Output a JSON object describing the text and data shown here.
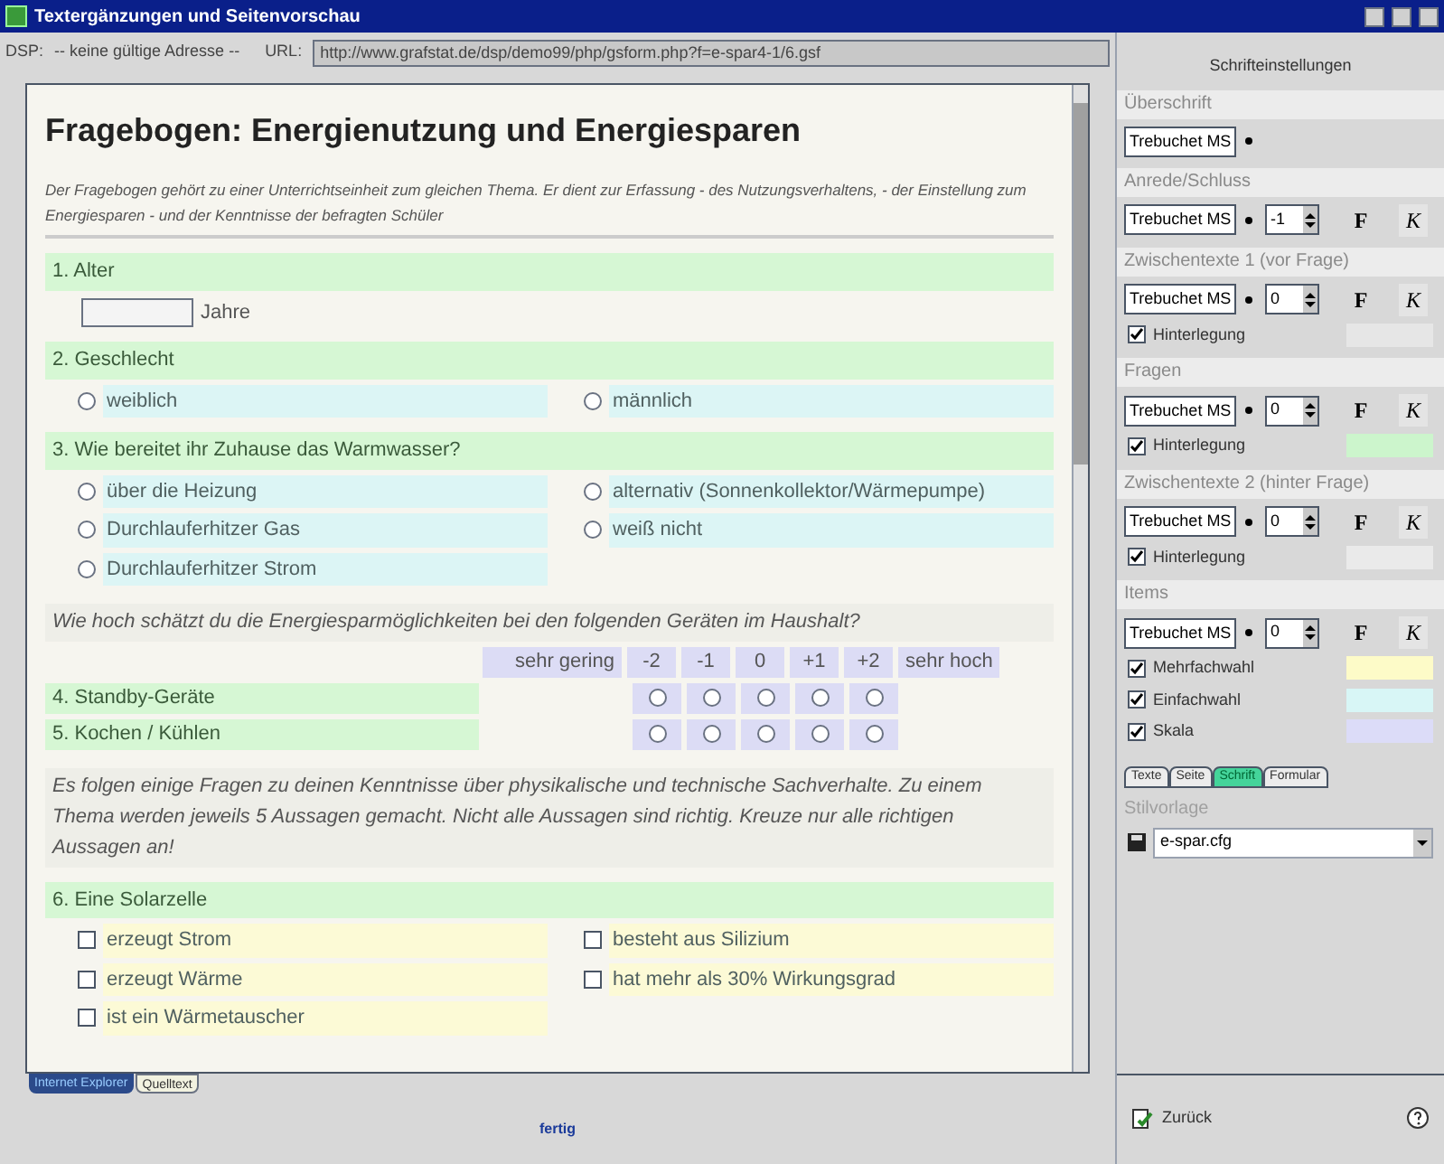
{
  "window": {
    "title": "Textergänzungen und Seitenvorschau"
  },
  "address": {
    "dsp_label": "DSP:",
    "dsp_value": "-- keine gültige Adresse --",
    "url_label": "URL:",
    "url": "http://www.grafstat.de/dsp/demo99/php/gsform.php?f=e-spar4-1/6.gsf"
  },
  "preview": {
    "title": "Fragebogen: Energienutzung und Energiesparen",
    "intro": "Der Fragebogen gehört zu einer Unterrichtseinheit zum gleichen Thema. Er dient zur Erfassung - des Nutzungsverhaltens, - der Einstellung zum Energiesparen - und der Kenntnisse der befragten Schüler",
    "blocks": [
      {
        "kind": "question",
        "label": "1. Alter"
      },
      {
        "kind": "textfield",
        "unit": "Jahre"
      },
      {
        "kind": "question",
        "label": "2. Geschlecht"
      },
      {
        "kind": "radio",
        "options": [
          {
            "label": "weiblich",
            "checked": false
          },
          {
            "label": "männlich",
            "checked": false
          }
        ]
      },
      {
        "kind": "question",
        "label": "3. Wie bereitet ihr Zuhause das Warmwasser?"
      },
      {
        "kind": "radio",
        "options": [
          {
            "label": "über die Heizung",
            "checked": false
          },
          {
            "label": "alternativ (Sonnenkollektor/Wärmepumpe)",
            "checked": false
          },
          {
            "label": "Durchlauferhitzer Gas",
            "checked": false
          },
          {
            "label": "weiß nicht",
            "checked": false
          },
          {
            "label": "Durchlauferhitzer Strom",
            "checked": false
          }
        ]
      },
      {
        "kind": "note",
        "text": "Wie hoch schätzt du die Energiesparmöglichkeiten bei den folgenden Geräten im Haushalt?"
      },
      {
        "kind": "scale",
        "low": "sehr gering",
        "high": "sehr hoch",
        "points": [
          "-2",
          "-1",
          "0",
          "+1",
          "+2"
        ],
        "rows": [
          {
            "label": "4. Standby-Geräte",
            "checked": [
              false,
              false,
              false,
              false,
              false
            ]
          },
          {
            "label": "5. Kochen / Kühlen",
            "checked": [
              false,
              false,
              false,
              false,
              false
            ]
          }
        ]
      },
      {
        "kind": "note",
        "text": "Es folgen einige Fragen zu deinen Kenntnisse über physikalische und technische Sachverhalte. Zu einem Thema werden jeweils 5 Aussagen gemacht. Nicht alle Aussagen sind richtig. Kreuze nur alle richtigen Aussagen an!"
      },
      {
        "kind": "question",
        "label": "6. Eine Solarzelle"
      },
      {
        "kind": "checkbox",
        "options": [
          {
            "label": "erzeugt Strom",
            "checked": false
          },
          {
            "label": "besteht aus Silizium",
            "checked": false
          },
          {
            "label": "erzeugt Wärme",
            "checked": false
          },
          {
            "label": "hat mehr als 30% Wirkungsgrad",
            "checked": false
          },
          {
            "label": "ist ein Wärmetauscher",
            "checked": false
          }
        ]
      }
    ]
  },
  "view_tabs": [
    {
      "label": "Internet Explorer",
      "selected": true
    },
    {
      "label": "Quelltext",
      "selected": false
    }
  ],
  "status": "fertig",
  "panel": {
    "title": "Schrifteinstellungen",
    "sections": [
      {
        "title": "Überschrift",
        "font": "Trebuchet MS"
      },
      {
        "title": "Anrede/Schluss",
        "font": "Trebuchet MS",
        "size": "-1",
        "bold": "F",
        "italic": "K"
      },
      {
        "title": "Zwischentexte 1 (vor Frage)",
        "font": "Trebuchet MS",
        "size": "0",
        "bold": "F",
        "italic": "K",
        "options": [
          {
            "label": "Hinterlegung",
            "checked": true,
            "color": "#e6e6e6"
          }
        ]
      },
      {
        "title": "Fragen",
        "font": "Trebuchet MS",
        "size": "0",
        "bold": "F",
        "italic": "K",
        "options": [
          {
            "label": "Hinterlegung",
            "checked": true,
            "color": "#ccf5cc"
          }
        ]
      },
      {
        "title": "Zwischentexte 2 (hinter Frage)",
        "font": "Trebuchet MS",
        "size": "0",
        "bold": "F",
        "italic": "K",
        "options": [
          {
            "label": "Hinterlegung",
            "checked": true,
            "color": "#eaeaea"
          }
        ]
      },
      {
        "title": "Items",
        "font": "Trebuchet MS",
        "size": "0",
        "bold": "F",
        "italic": "K",
        "options": [
          {
            "label": "Mehrfachwahl",
            "checked": true,
            "color": "#fdfbc8"
          },
          {
            "label": "Einfachwahl",
            "checked": true,
            "color": "#d8f6f6"
          },
          {
            "label": "Skala",
            "checked": true,
            "color": "#dcdcf8"
          }
        ]
      }
    ],
    "tabs": [
      {
        "label": "Texte",
        "selected": false
      },
      {
        "label": "Seite",
        "selected": false
      },
      {
        "label": "Schrift",
        "selected": true
      },
      {
        "label": "Formular",
        "selected": false
      }
    ],
    "style_label": "Stilvorlage",
    "style_file": "e-spar.cfg",
    "back": "Zurück"
  }
}
